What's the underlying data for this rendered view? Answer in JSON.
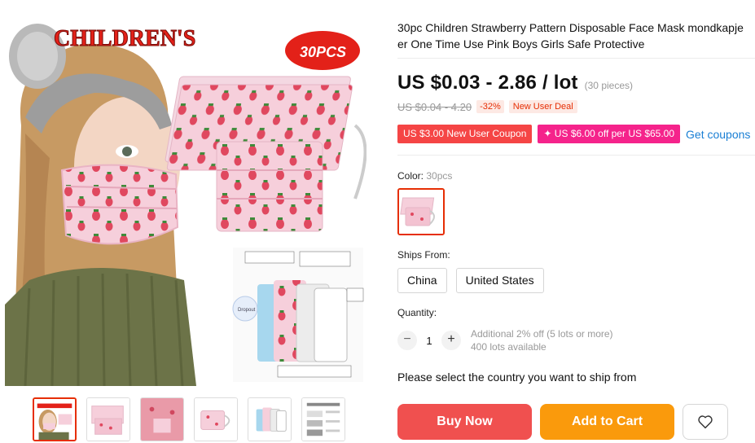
{
  "gallery": {
    "banner_text": "CHILDREN'S",
    "badge_text": "30PCS",
    "inset_label": "Dropout",
    "thumbnails": [
      {
        "name": "thumb-1",
        "active": true
      },
      {
        "name": "thumb-2",
        "active": false
      },
      {
        "name": "thumb-3",
        "active": false
      },
      {
        "name": "thumb-4",
        "active": false
      },
      {
        "name": "thumb-5",
        "active": false
      },
      {
        "name": "thumb-6",
        "active": false
      }
    ]
  },
  "product": {
    "title": "30pc Children Strawberry Pattern Disposable Face Mask mondkapje\ner One Time Use Pink Boys Girls Safe Protective",
    "price": "US $0.03 - 2.86 / lot",
    "price_unit": "(30 pieces)",
    "original_price": "US $0.04 - 4.20",
    "discount": "-32%",
    "new_user_deal": "New User Deal",
    "coupon_1": "US $3.00 New User Coupon",
    "coupon_2": "✦ US $6.00 off per US $65.00",
    "get_coupons": "Get coupons"
  },
  "options": {
    "color_label": "Color:",
    "color_value": "30pcs",
    "ships_from_label": "Ships From:",
    "ships_from": [
      "China",
      "United States"
    ]
  },
  "quantity": {
    "label": "Quantity:",
    "minus": "−",
    "value": "1",
    "plus": "+",
    "note_1": "Additional 2% off (5 lots or more)",
    "note_2": "400 lots available"
  },
  "ship_message": "Please select the country you want to ship from",
  "actions": {
    "buy_now": "Buy Now",
    "add_to_cart": "Add to Cart",
    "wishlist_icon": "heart-icon"
  },
  "colors": {
    "accent": "#e62e04",
    "buy": "#f0504f",
    "cart": "#fa9a0c",
    "coupon_red": "#f54545",
    "coupon_pink": "#f5238b",
    "link": "#1a7fd4",
    "mask_pink": "#f4c9d6"
  }
}
